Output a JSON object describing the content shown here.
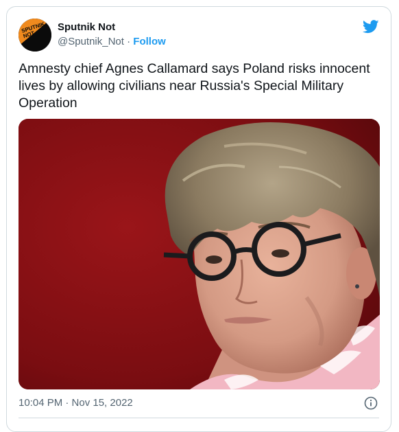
{
  "tweet": {
    "author": {
      "display_name": "Sputnik Not",
      "handle": "@Sputnik_Not",
      "separator": " · ",
      "follow_label": "Follow",
      "avatar_logo_text": "SPUTNIK NOT"
    },
    "text": "Amnesty chief Agnes Callamard says Poland risks innocent lives by allowing civilians near Russia's Special Military Operation",
    "timestamp": "10:04 PM · Nov 15, 2022",
    "media": {
      "subject": "photo"
    }
  },
  "colors": {
    "brand_blue": "#1d9bf0",
    "text_primary": "#0f1419",
    "text_secondary": "#536471",
    "avatar_orange": "#f08a1e",
    "photo_background_red": "#7e0e12"
  },
  "icons": {
    "platform": "twitter-bird-icon",
    "info": "info-icon"
  }
}
